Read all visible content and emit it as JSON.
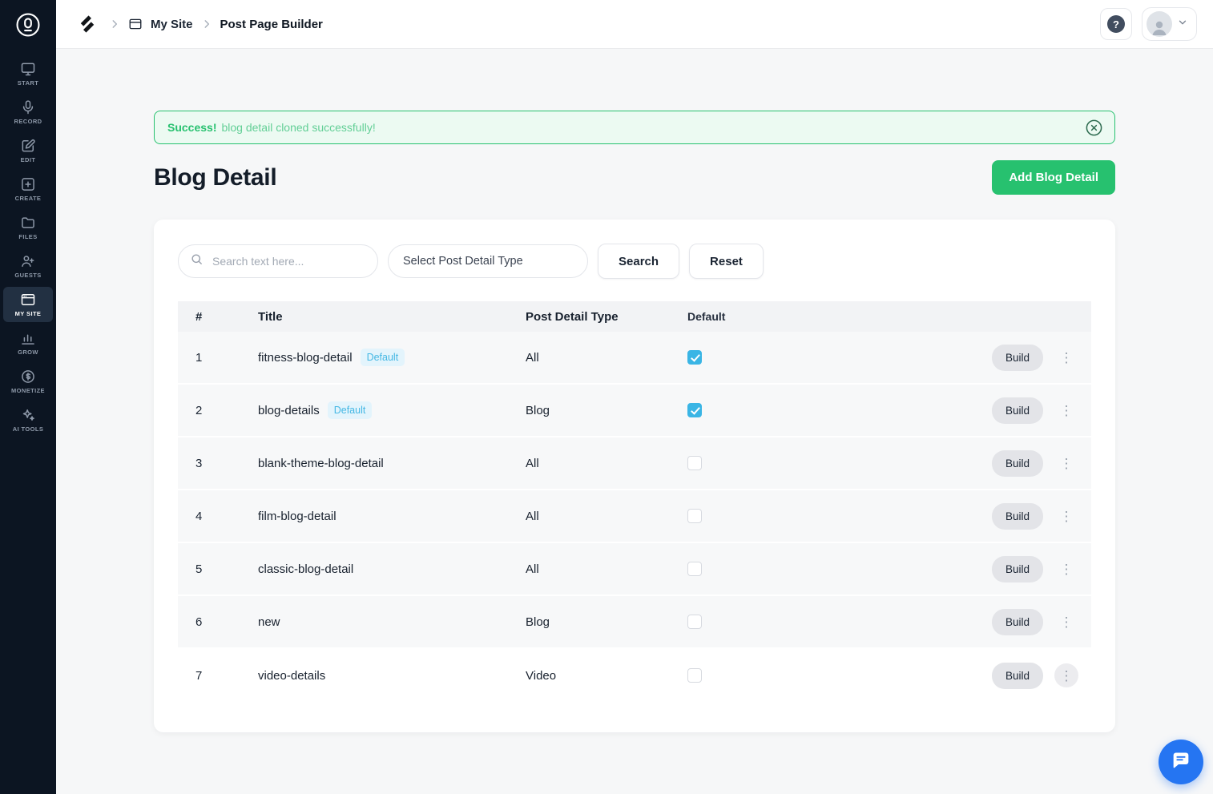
{
  "colors": {
    "sidebar_bg": "#0c1522",
    "accent_green": "#27c16f",
    "success_text": "#27c16f",
    "alert_border": "#27c16f",
    "alert_bg": "#ecfaf2",
    "checkbox_blue": "#3ab5e5",
    "badge_bg": "#e3f4fc",
    "badge_text": "#45b8e4",
    "chat_blue": "#2575f2"
  },
  "icons": {
    "sidebar_logo": "podcastle-logo",
    "header_logo": "brand-logo",
    "breadcrumb_site": "browser-icon",
    "breadcrumb_separator": "chevron-right-icon",
    "search": "search-icon",
    "help": "help-icon",
    "avatar": "avatar-person-icon",
    "avatar_chevron": "chevron-down-icon",
    "alert_close": "close-circle-icon",
    "row_menu": "kebab-icon",
    "chat": "chat-bubble-icon"
  },
  "sidebar": {
    "items": [
      {
        "label": "START",
        "icon": "start-icon",
        "active": false
      },
      {
        "label": "RECORD",
        "icon": "record-icon",
        "active": false
      },
      {
        "label": "EDIT",
        "icon": "edit-icon",
        "active": false
      },
      {
        "label": "CREATE",
        "icon": "create-icon",
        "active": false
      },
      {
        "label": "FILES",
        "icon": "files-icon",
        "active": false
      },
      {
        "label": "GUESTS",
        "icon": "guests-icon",
        "active": false
      },
      {
        "label": "MY SITE",
        "icon": "mysite-icon",
        "active": true
      },
      {
        "label": "GROW",
        "icon": "grow-icon",
        "active": false
      },
      {
        "label": "MONETIZE",
        "icon": "monetize-icon",
        "active": false
      },
      {
        "label": "AI TOOLS",
        "icon": "aitools-icon",
        "active": false
      }
    ]
  },
  "header": {
    "breadcrumb": {
      "site": "My Site",
      "page": "Post Page Builder"
    },
    "help_label": "?"
  },
  "alert": {
    "title": "Success!",
    "message": "blog detail cloned successfully!"
  },
  "page": {
    "title": "Blog Detail",
    "add_button_label": "Add Blog Detail"
  },
  "filters": {
    "search_placeholder": "Search text here...",
    "select_placeholder": "Select Post Detail Type",
    "search_button": "Search",
    "reset_button": "Reset"
  },
  "table": {
    "headers": [
      "#",
      "Title",
      "Post Detail Type",
      "Default"
    ],
    "rows": [
      {
        "num": "1",
        "title": "fitness-blog-detail",
        "badge": "Default",
        "type": "All",
        "default_checked": true,
        "build_label": "Build"
      },
      {
        "num": "2",
        "title": "blog-details",
        "badge": "Default",
        "type": "Blog",
        "default_checked": true,
        "build_label": "Build"
      },
      {
        "num": "3",
        "title": "blank-theme-blog-detail",
        "badge": null,
        "type": "All",
        "default_checked": false,
        "build_label": "Build"
      },
      {
        "num": "4",
        "title": "film-blog-detail",
        "badge": null,
        "type": "All",
        "default_checked": false,
        "build_label": "Build"
      },
      {
        "num": "5",
        "title": "classic-blog-detail",
        "badge": null,
        "type": "All",
        "default_checked": false,
        "build_label": "Build"
      },
      {
        "num": "6",
        "title": "new",
        "badge": null,
        "type": "Blog",
        "default_checked": false,
        "build_label": "Build"
      },
      {
        "num": "7",
        "title": "video-details",
        "badge": null,
        "type": "Video",
        "default_checked": false,
        "build_label": "Build"
      }
    ]
  }
}
